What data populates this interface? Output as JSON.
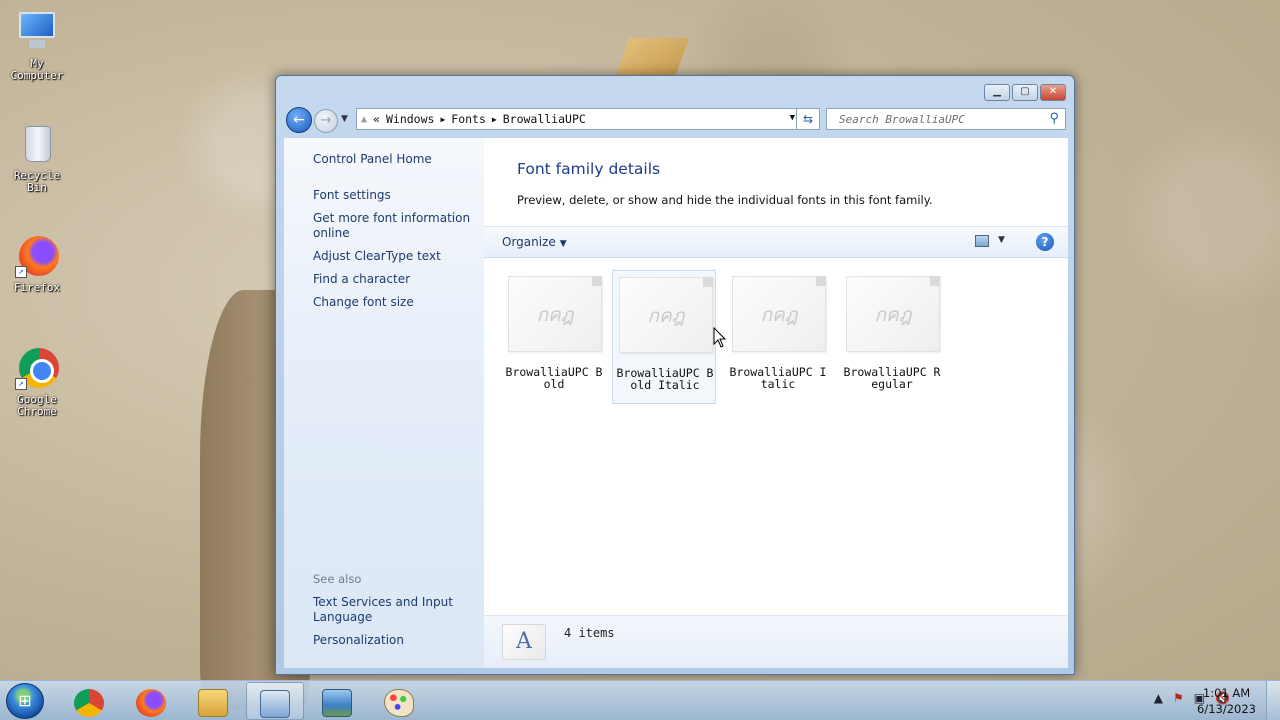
{
  "desktop": {
    "icons": [
      {
        "label": "My Computer"
      },
      {
        "label": "Recycle Bin"
      },
      {
        "label": "Firefox"
      },
      {
        "label": "Google Chrome"
      }
    ]
  },
  "window": {
    "address": {
      "crumbs": [
        "Windows",
        "Fonts",
        "BrowalliaUPC"
      ],
      "prefix": "«"
    },
    "search_placeholder": "Search BrowalliaUPC",
    "left_pane": {
      "home": "Control Panel Home",
      "links": [
        "Font settings",
        "Get more font information online",
        "Adjust ClearType text",
        "Find a character",
        "Change font size"
      ],
      "see_also_label": "See also",
      "see_also": [
        "Text Services and Input Language",
        "Personalization"
      ]
    },
    "title": "Font family details",
    "description": "Preview, delete, or show and hide the individual fonts in this font family.",
    "toolbar": {
      "organize": "Organize"
    },
    "fonts": [
      {
        "name": "BrowalliaUPC Bold",
        "preview": "กคฎ"
      },
      {
        "name": "BrowalliaUPC Bold Italic",
        "preview": "กคฎ"
      },
      {
        "name": "BrowalliaUPC Italic",
        "preview": "กคฎ"
      },
      {
        "name": "BrowalliaUPC Regular",
        "preview": "กคฎ"
      }
    ],
    "details": {
      "count": "4 items",
      "icon_letter": "A"
    }
  },
  "taskbar": {
    "time": "1:01 AM",
    "date": "6/13/2023"
  },
  "colors": {
    "link": "#1e3b6e",
    "title": "#1e3b8e",
    "close_button": "#c8452e"
  }
}
